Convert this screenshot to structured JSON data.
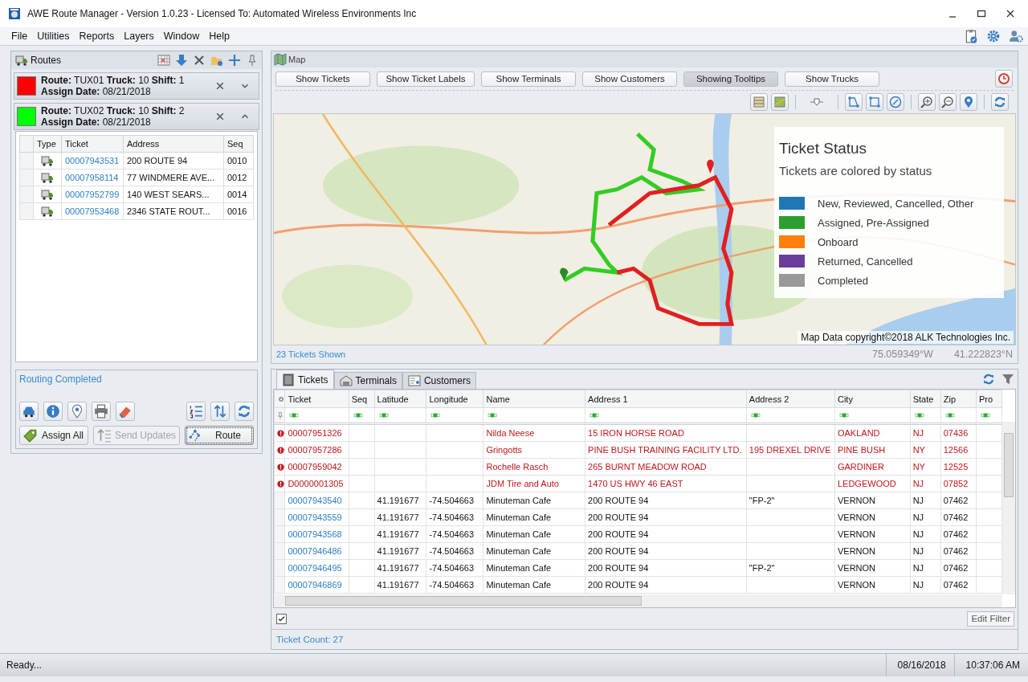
{
  "window": {
    "title": "AWE Route Manager - Version 1.0.23 - Licensed To: Automated Wireless Environments Inc"
  },
  "menu": [
    "File",
    "Utilities",
    "Reports",
    "Layers",
    "Window",
    "Help"
  ],
  "routes_panel": {
    "title": "Routes",
    "routes": [
      {
        "color": "#ff0000",
        "line1": "**Route:** TUX01  **Truck:** 10  **Shift:** 1",
        "line2": "**Assign Date:** 08/21/2018",
        "expanded": false
      },
      {
        "color": "#00ff00",
        "line1": "**Route:** TUX02  **Truck:** 10  **Shift:** 2",
        "line2": "**Assign Date:** 08/21/2018",
        "expanded": true
      }
    ],
    "columns": [
      "Type",
      "Ticket",
      "Address",
      "Seq"
    ],
    "rows": [
      {
        "ticket": "00007943531",
        "address": "200 ROUTE 94",
        "seq": "0010"
      },
      {
        "ticket": "00007958114",
        "address": "77 WINDMERE AVE...",
        "seq": "0012"
      },
      {
        "ticket": "00007952799",
        "address": "140 WEST SEARS...",
        "seq": "0014"
      },
      {
        "ticket": "00007953468",
        "address": "2346 STATE ROUT...",
        "seq": "0016"
      }
    ],
    "status": "Routing Completed",
    "buttons": [
      {
        "label": "Assign All",
        "kind": "assign",
        "disabled": false
      },
      {
        "label": "Send Updates",
        "kind": "send",
        "disabled": true
      },
      {
        "label": "Route",
        "kind": "route",
        "disabled": false
      }
    ]
  },
  "map_panel": {
    "title": "Map",
    "buttons": [
      {
        "label": "Show Tickets",
        "selected": false
      },
      {
        "label": "Show Ticket Labels",
        "selected": false
      },
      {
        "label": "Show Terminals",
        "selected": false
      },
      {
        "label": "Show Customers",
        "selected": false
      },
      {
        "label": "Showing Tooltips",
        "selected": true
      },
      {
        "label": "Show Trucks",
        "selected": false
      }
    ],
    "legend": {
      "title": "Ticket Status",
      "subtitle": "Tickets are colored by status",
      "items": [
        {
          "label": "New, Reviewed, Cancelled, Other",
          "color": "#1f77b4"
        },
        {
          "label": "Assigned, Pre-Assigned",
          "color": "#2ca02c"
        },
        {
          "label": "Onboard",
          "color": "#ff7f0e"
        },
        {
          "label": "Returned, Cancelled",
          "color": "#6a3d9a"
        },
        {
          "label": "Completed",
          "color": "#999999"
        }
      ]
    },
    "copyright": "Map Data copyright©2018 ALK Technologies Inc.",
    "tickets_shown": "23 Tickets Shown",
    "longitude": "75.059349°W",
    "latitude": "41.222823°N"
  },
  "tickets_panel": {
    "tabs": [
      {
        "label": "Tickets",
        "selected": true
      },
      {
        "label": "Terminals",
        "selected": false
      },
      {
        "label": "Customers",
        "selected": false
      }
    ],
    "columns": [
      "Ticket",
      "Seq",
      "Latitude",
      "Longitude",
      "Name",
      "Address 1",
      "Address 2",
      "City",
      "State",
      "Zip",
      "Pro"
    ],
    "rows": [
      {
        "flagged": true,
        "cells": [
          "00007951326",
          "",
          "",
          "",
          "Nilda Neese",
          "15 IRON HORSE ROAD",
          "",
          "OAKLAND",
          "NJ",
          "07436"
        ]
      },
      {
        "flagged": true,
        "cells": [
          "00007957286",
          "",
          "",
          "",
          "Gringotts",
          "PINE BUSH TRAINING FACILITY LTD.",
          "195 DREXEL DRIVE",
          "PINE BUSH",
          "NY",
          "12566"
        ]
      },
      {
        "flagged": true,
        "cells": [
          "00007959042",
          "",
          "",
          "",
          "Rochelle Rasch",
          "265 BURNT MEADOW ROAD",
          "",
          "GARDINER",
          "NY",
          "12525"
        ]
      },
      {
        "flagged": true,
        "cells": [
          "D0000001305",
          "",
          "",
          "",
          "JDM Tire and Auto",
          "1470 US HWY 46 EAST",
          "",
          "LEDGEWOOD",
          "NJ",
          "07852"
        ]
      },
      {
        "flagged": false,
        "cells": [
          "00007943540",
          "",
          "41.191677",
          "-74.504663",
          "Minuteman Cafe",
          "200 ROUTE 94",
          "\"FP-2\"",
          "VERNON",
          "NJ",
          "07462"
        ]
      },
      {
        "flagged": false,
        "cells": [
          "00007943559",
          "",
          "41.191677",
          "-74.504663",
          "Minuteman Cafe",
          "200 ROUTE 94",
          "",
          "VERNON",
          "NJ",
          "07462"
        ]
      },
      {
        "flagged": false,
        "cells": [
          "00007943568",
          "",
          "41.191677",
          "-74.504663",
          "Minuteman Cafe",
          "200 ROUTE 94",
          "",
          "VERNON",
          "NJ",
          "07462"
        ]
      },
      {
        "flagged": false,
        "cells": [
          "00007946486",
          "",
          "41.191677",
          "-74.504663",
          "Minuteman Cafe",
          "200 ROUTE 94",
          "",
          "VERNON",
          "NJ",
          "07462"
        ]
      },
      {
        "flagged": false,
        "cells": [
          "00007946495",
          "",
          "41.191677",
          "-74.504663",
          "Minuteman Cafe",
          "200 ROUTE 94",
          "\"FP-2\"",
          "VERNON",
          "NJ",
          "07462"
        ]
      },
      {
        "flagged": false,
        "cells": [
          "00007946869",
          "",
          "41.191677",
          "-74.504663",
          "Minuteman Cafe",
          "200 ROUTE 94",
          "",
          "VERNON",
          "NJ",
          "07462"
        ]
      }
    ],
    "filter_checked": true,
    "edit_filter": "Edit Filter",
    "ticket_count": "Ticket Count: 27"
  },
  "status_bar": {
    "text": "Ready...",
    "date": "08/16/2018",
    "time": "10:37:06 AM"
  }
}
